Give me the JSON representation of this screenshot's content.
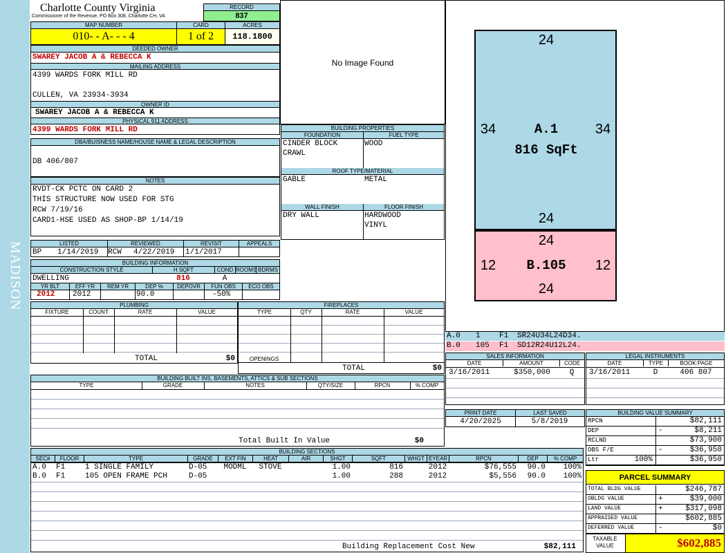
{
  "side_label": "MADISON",
  "header": {
    "county": "Charlotte County Virginia",
    "subtitle": "Commissioner of the Revenue, PO Box 308, Charlotte CH, VA",
    "record_label": "RECORD",
    "record": "837",
    "map_number_label": "MAP NUMBER",
    "map_number": "010- - A- - - 4",
    "card_label": "CARD",
    "card": "1 of 2",
    "acres_label": "ACRES",
    "acres": "118.1800"
  },
  "owner": {
    "deeded_owner_label": "DEEDED OWNER",
    "deeded_owner": "SWAREY JACOB A & REBECCA K",
    "mailing_label": "MAILING ADDRESS",
    "mailing_line1": "4399 WARDS FORK MILL RD",
    "mailing_line2": "CULLEN, VA 23934-3934",
    "owner_id_label": "OWNER ID",
    "owner_id": "SWAREY JACOB A & REBECCA K",
    "physical_label": "PHYSICAL 911 ADDRESS",
    "physical": "4399 WARDS FORK MILL RD"
  },
  "legal": {
    "label": "DBA/BUISNESS NAME/HOUSE NAME & LEGAL DESCRIPTION",
    "text": "DB 406/807"
  },
  "notes": {
    "label": "NOTES",
    "lines": [
      "RVDT-CK PCTC ON CARD 2",
      "THIS STRUCTURE NOW USED FOR STG",
      "RCW 7/19/16",
      "CARD1-HSE USED AS SHOP-BP 1/14/19"
    ]
  },
  "dates": {
    "listed_label": "LISTED",
    "listed_by": "BP",
    "listed": "1/14/2019",
    "reviewed_label": "REVIEWED",
    "reviewed_by": "RCW",
    "reviewed": "4/22/2019",
    "revisit_label": "REVISIT",
    "revisit": "1/1/2017",
    "appeals_label": "APPEALS"
  },
  "building_info": {
    "label": "BUILDING INFORMATION",
    "construction_style_label": "CONSTRUCTION STYLE",
    "construction_style": "DWELLING",
    "hsqft_label": "H SQFT",
    "hsqft": "816",
    "cond_label": "COND",
    "cond": "A",
    "rooms_label": "ROOMS",
    "bdrms_label": "BDRMS",
    "yrblt_label": "YR BLT",
    "yrblt": "2012",
    "effyr_label": "EFF YR",
    "effyr": "2012",
    "remyr_label": "REM YR",
    "dep_label": "DEP %",
    "dep": "90.0",
    "depovr_label": "DEPOVR",
    "funobs_label": "FUN OBS",
    "funobs": "-50%",
    "ecoobs_label": "ECO OBS"
  },
  "image": {
    "text": "No Image Found"
  },
  "building_properties": {
    "label": "BUILDING PROPERTIES",
    "foundation_label": "FOUNDATION",
    "foundation": [
      "CINDER BLOCK",
      "CRAWL"
    ],
    "fuel_label": "FUEL TYPE",
    "fuel": "WOOD",
    "roof_label": "ROOF TYPE/MATERIAL",
    "roof_type": "GABLE",
    "roof_material": "METAL",
    "wall_label": "WALL FINISH",
    "wall": "DRY WALL",
    "floor_label": "FLOOR FINISH",
    "floor": [
      "HARDWOOD",
      "VINYL"
    ]
  },
  "sketch": {
    "a": {
      "label": "A.1",
      "area": "816 SqFt",
      "top": "24",
      "bottom": "24",
      "left": "34",
      "right": "34",
      "color": "#add8e6"
    },
    "b": {
      "label": "B.105",
      "top": "24",
      "bottom": "24",
      "left": "12",
      "right": "12",
      "color": "#ffc0cb"
    },
    "legend": [
      {
        "sec": "A.0",
        "code": "1",
        "floor": "F1",
        "path": "SR24U34L24D34."
      },
      {
        "sec": "B.0",
        "code": "105",
        "floor": "F1",
        "path": "SD12R24U12L24."
      }
    ]
  },
  "plumbing": {
    "label": "PLUMBING",
    "columns": [
      "FIXTURE",
      "COUNT",
      "RATE",
      "VALUE"
    ],
    "total_label": "TOTAL",
    "total": "$0"
  },
  "fireplaces": {
    "label": "FIREPLACES",
    "columns": [
      "TYPE",
      "QTY",
      "RATE",
      "VALUE"
    ],
    "openings_label": "OPENINGS",
    "total_label": "TOTAL",
    "total": "$0"
  },
  "builtins": {
    "label": "BUILDING BUILT INS, BASEMENTS, ATTICS & SUB SECTIONS",
    "columns": [
      "TYPE",
      "GRADE",
      "NOTES",
      "QTY/SIZE",
      "RPCN",
      "% COMP"
    ],
    "total_label": "Total Built In Value",
    "total": "$0"
  },
  "sections": {
    "label": "BUILDING SECTIONS",
    "columns": [
      "SEC#",
      "FLOOR",
      "TYPE",
      "GRADE",
      "EXT FIN",
      "HEAT",
      "AIR",
      "SHGT",
      "SQFT",
      "WHGT",
      "EYEAR",
      "RPCN",
      "DEP",
      "% COMP"
    ],
    "rows": [
      [
        "A.0",
        "F1",
        "1 SINGLE FAMILY",
        "D-05",
        "MODML",
        "STOVE",
        "",
        "1.00",
        "816",
        "",
        "2012",
        "$76,555",
        "90.0",
        "100%"
      ],
      [
        "B.0",
        "F1",
        "105 OPEN FRAME PCH",
        "D-05",
        "",
        "",
        "",
        "1.00",
        "288",
        "",
        "2012",
        "$5,556",
        "90.0",
        "100%"
      ]
    ],
    "replacement_label": "Building Replacement Cost New",
    "replacement": "$82,111"
  },
  "sales": {
    "label": "SALES INFORMATION",
    "columns": [
      "DATE",
      "AMOUNT",
      "CODE"
    ],
    "rows": [
      [
        "3/16/2011",
        "$350,000",
        "Q"
      ]
    ]
  },
  "legal_instruments": {
    "label": "LEGAL INSTRUMENTS",
    "columns": [
      "DATE",
      "TYPE",
      "BOOK:PAGE"
    ],
    "rows": [
      [
        "3/16/2011",
        "D",
        "406 807"
      ]
    ]
  },
  "print": {
    "print_label": "PRINT DATE",
    "print_date": "4/20/2025",
    "saved_label": "LAST SAVED",
    "saved_date": "5/8/2019"
  },
  "value_summary": {
    "label": "BUILDING VALUE SUMMARY",
    "rows": [
      {
        "label": "RPCN",
        "sign": "",
        "value": "$82,111"
      },
      {
        "label": "DEP",
        "sign": "-",
        "value": "$8,211"
      },
      {
        "label": "RCLND",
        "sign": "",
        "value": "$73,900"
      },
      {
        "label": "OBS F/E",
        "sign": "-",
        "value": "$36,950"
      },
      {
        "label": "Ltr",
        "pct": "100%",
        "sign": "",
        "value": "$36,950"
      }
    ]
  },
  "parcel_summary": {
    "label": "PARCEL SUMMARY",
    "rows": [
      {
        "label": "TOTAL BLDG VALUE",
        "sign": "",
        "value": "$246,787"
      },
      {
        "label": "OBLDG VALUE",
        "sign": "+",
        "value": "$39,000"
      },
      {
        "label": "LAND VALUE",
        "sign": "+",
        "value": "$317,098"
      },
      {
        "label": "APPRAISED VALUE",
        "sign": "",
        "value": "$602,885"
      },
      {
        "label": "DEFERRED VALUE",
        "sign": "-",
        "value": "$0"
      }
    ],
    "taxable_label_1": "TAXABLE",
    "taxable_label_2": "VALUE",
    "taxable": "$602,885"
  }
}
